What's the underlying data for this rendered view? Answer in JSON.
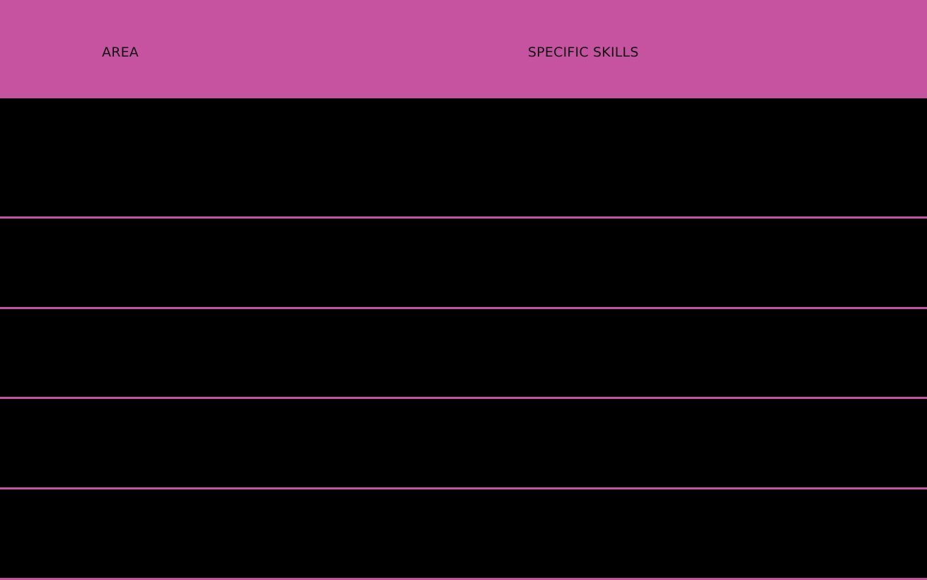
{
  "table": {
    "header": {
      "area_label": "AREA",
      "skills_label": "SPECIFIC SKILLS"
    },
    "rows": [
      {
        "area": "",
        "skills": ""
      },
      {
        "area": "",
        "skills": ""
      },
      {
        "area": "",
        "skills": ""
      },
      {
        "area": "",
        "skills": ""
      },
      {
        "area": "",
        "skills": ""
      }
    ]
  },
  "colors": {
    "accent": "#c653a0",
    "row_background": "#000000",
    "header_text": "#111111"
  }
}
